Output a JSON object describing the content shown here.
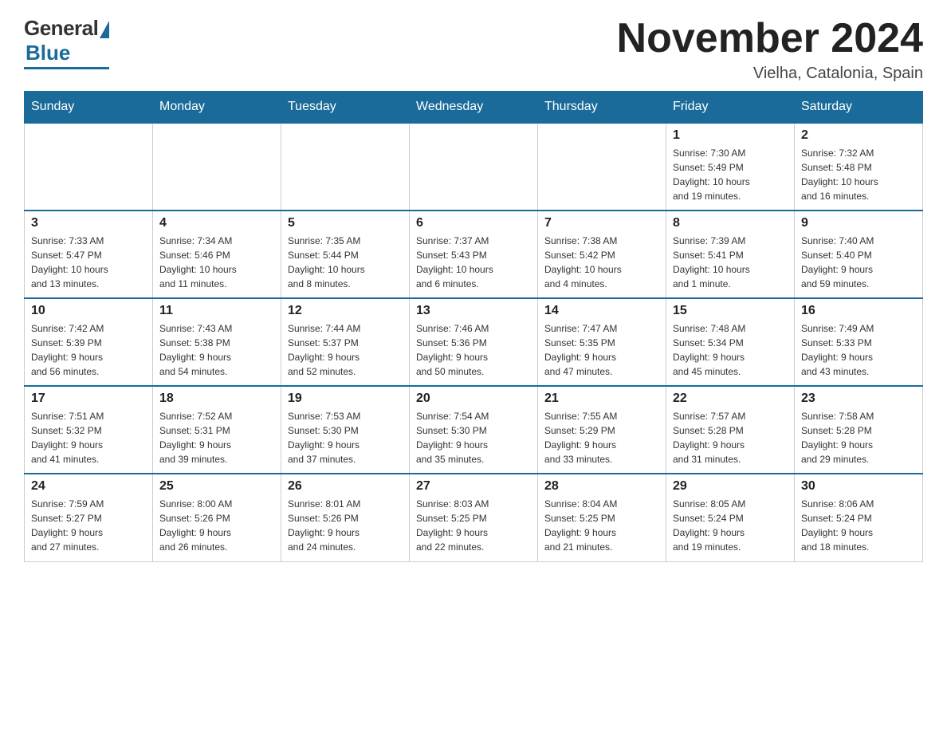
{
  "logo": {
    "general": "General",
    "blue": "Blue"
  },
  "header": {
    "title": "November 2024",
    "location": "Vielha, Catalonia, Spain"
  },
  "days_of_week": [
    "Sunday",
    "Monday",
    "Tuesday",
    "Wednesday",
    "Thursday",
    "Friday",
    "Saturday"
  ],
  "weeks": [
    [
      {
        "day": "",
        "info": "",
        "empty": true
      },
      {
        "day": "",
        "info": "",
        "empty": true
      },
      {
        "day": "",
        "info": "",
        "empty": true
      },
      {
        "day": "",
        "info": "",
        "empty": true
      },
      {
        "day": "",
        "info": "",
        "empty": true
      },
      {
        "day": "1",
        "info": "Sunrise: 7:30 AM\nSunset: 5:49 PM\nDaylight: 10 hours\nand 19 minutes.",
        "empty": false
      },
      {
        "day": "2",
        "info": "Sunrise: 7:32 AM\nSunset: 5:48 PM\nDaylight: 10 hours\nand 16 minutes.",
        "empty": false
      }
    ],
    [
      {
        "day": "3",
        "info": "Sunrise: 7:33 AM\nSunset: 5:47 PM\nDaylight: 10 hours\nand 13 minutes.",
        "empty": false
      },
      {
        "day": "4",
        "info": "Sunrise: 7:34 AM\nSunset: 5:46 PM\nDaylight: 10 hours\nand 11 minutes.",
        "empty": false
      },
      {
        "day": "5",
        "info": "Sunrise: 7:35 AM\nSunset: 5:44 PM\nDaylight: 10 hours\nand 8 minutes.",
        "empty": false
      },
      {
        "day": "6",
        "info": "Sunrise: 7:37 AM\nSunset: 5:43 PM\nDaylight: 10 hours\nand 6 minutes.",
        "empty": false
      },
      {
        "day": "7",
        "info": "Sunrise: 7:38 AM\nSunset: 5:42 PM\nDaylight: 10 hours\nand 4 minutes.",
        "empty": false
      },
      {
        "day": "8",
        "info": "Sunrise: 7:39 AM\nSunset: 5:41 PM\nDaylight: 10 hours\nand 1 minute.",
        "empty": false
      },
      {
        "day": "9",
        "info": "Sunrise: 7:40 AM\nSunset: 5:40 PM\nDaylight: 9 hours\nand 59 minutes.",
        "empty": false
      }
    ],
    [
      {
        "day": "10",
        "info": "Sunrise: 7:42 AM\nSunset: 5:39 PM\nDaylight: 9 hours\nand 56 minutes.",
        "empty": false
      },
      {
        "day": "11",
        "info": "Sunrise: 7:43 AM\nSunset: 5:38 PM\nDaylight: 9 hours\nand 54 minutes.",
        "empty": false
      },
      {
        "day": "12",
        "info": "Sunrise: 7:44 AM\nSunset: 5:37 PM\nDaylight: 9 hours\nand 52 minutes.",
        "empty": false
      },
      {
        "day": "13",
        "info": "Sunrise: 7:46 AM\nSunset: 5:36 PM\nDaylight: 9 hours\nand 50 minutes.",
        "empty": false
      },
      {
        "day": "14",
        "info": "Sunrise: 7:47 AM\nSunset: 5:35 PM\nDaylight: 9 hours\nand 47 minutes.",
        "empty": false
      },
      {
        "day": "15",
        "info": "Sunrise: 7:48 AM\nSunset: 5:34 PM\nDaylight: 9 hours\nand 45 minutes.",
        "empty": false
      },
      {
        "day": "16",
        "info": "Sunrise: 7:49 AM\nSunset: 5:33 PM\nDaylight: 9 hours\nand 43 minutes.",
        "empty": false
      }
    ],
    [
      {
        "day": "17",
        "info": "Sunrise: 7:51 AM\nSunset: 5:32 PM\nDaylight: 9 hours\nand 41 minutes.",
        "empty": false
      },
      {
        "day": "18",
        "info": "Sunrise: 7:52 AM\nSunset: 5:31 PM\nDaylight: 9 hours\nand 39 minutes.",
        "empty": false
      },
      {
        "day": "19",
        "info": "Sunrise: 7:53 AM\nSunset: 5:30 PM\nDaylight: 9 hours\nand 37 minutes.",
        "empty": false
      },
      {
        "day": "20",
        "info": "Sunrise: 7:54 AM\nSunset: 5:30 PM\nDaylight: 9 hours\nand 35 minutes.",
        "empty": false
      },
      {
        "day": "21",
        "info": "Sunrise: 7:55 AM\nSunset: 5:29 PM\nDaylight: 9 hours\nand 33 minutes.",
        "empty": false
      },
      {
        "day": "22",
        "info": "Sunrise: 7:57 AM\nSunset: 5:28 PM\nDaylight: 9 hours\nand 31 minutes.",
        "empty": false
      },
      {
        "day": "23",
        "info": "Sunrise: 7:58 AM\nSunset: 5:28 PM\nDaylight: 9 hours\nand 29 minutes.",
        "empty": false
      }
    ],
    [
      {
        "day": "24",
        "info": "Sunrise: 7:59 AM\nSunset: 5:27 PM\nDaylight: 9 hours\nand 27 minutes.",
        "empty": false
      },
      {
        "day": "25",
        "info": "Sunrise: 8:00 AM\nSunset: 5:26 PM\nDaylight: 9 hours\nand 26 minutes.",
        "empty": false
      },
      {
        "day": "26",
        "info": "Sunrise: 8:01 AM\nSunset: 5:26 PM\nDaylight: 9 hours\nand 24 minutes.",
        "empty": false
      },
      {
        "day": "27",
        "info": "Sunrise: 8:03 AM\nSunset: 5:25 PM\nDaylight: 9 hours\nand 22 minutes.",
        "empty": false
      },
      {
        "day": "28",
        "info": "Sunrise: 8:04 AM\nSunset: 5:25 PM\nDaylight: 9 hours\nand 21 minutes.",
        "empty": false
      },
      {
        "day": "29",
        "info": "Sunrise: 8:05 AM\nSunset: 5:24 PM\nDaylight: 9 hours\nand 19 minutes.",
        "empty": false
      },
      {
        "day": "30",
        "info": "Sunrise: 8:06 AM\nSunset: 5:24 PM\nDaylight: 9 hours\nand 18 minutes.",
        "empty": false
      }
    ]
  ]
}
